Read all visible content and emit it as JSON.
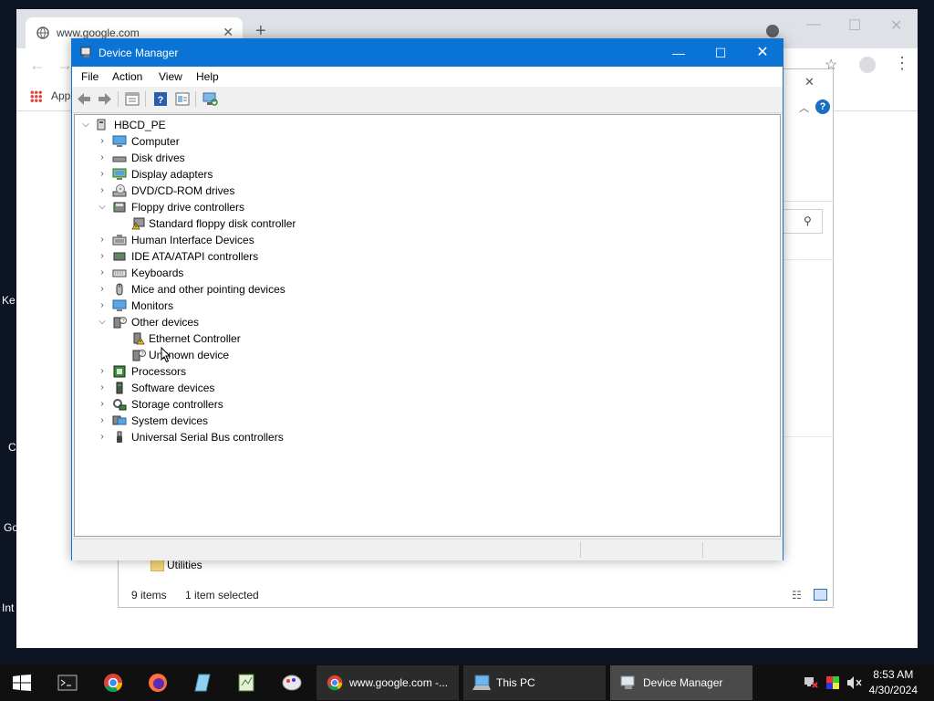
{
  "desktop": {
    "side_labels": [
      "Ke",
      "C",
      "Go",
      "Int"
    ]
  },
  "chrome": {
    "tab_title": "www.google.com",
    "apps_label": "Apps"
  },
  "explorer": {
    "folder_label": "Utilities",
    "item_count": "9 items",
    "selection": "1 item selected"
  },
  "device_manager": {
    "title": "Device Manager",
    "menu": [
      "File",
      "Action",
      "View",
      "Help"
    ],
    "root": "HBCD_PE",
    "tree": [
      {
        "label": "Computer",
        "expanded": false,
        "icon": "computer-icon"
      },
      {
        "label": "Disk drives",
        "expanded": false,
        "icon": "disk-icon"
      },
      {
        "label": "Display adapters",
        "expanded": false,
        "icon": "display-icon"
      },
      {
        "label": "DVD/CD-ROM drives",
        "expanded": false,
        "icon": "dvd-icon"
      },
      {
        "label": "Floppy drive controllers",
        "expanded": true,
        "icon": "floppy-icon",
        "children": [
          {
            "label": "Standard floppy disk controller",
            "icon": "warning-device-icon"
          }
        ]
      },
      {
        "label": "Human Interface Devices",
        "expanded": false,
        "icon": "hid-icon"
      },
      {
        "label": "IDE ATA/ATAPI controllers",
        "expanded": false,
        "icon": "ide-icon"
      },
      {
        "label": "Keyboards",
        "expanded": false,
        "icon": "keyboard-icon"
      },
      {
        "label": "Mice and other pointing devices",
        "expanded": false,
        "icon": "mouse-icon"
      },
      {
        "label": "Monitors",
        "expanded": false,
        "icon": "monitor-icon"
      },
      {
        "label": "Other devices",
        "expanded": true,
        "icon": "unknown-device-icon",
        "children": [
          {
            "label": "Ethernet Controller",
            "icon": "warning-device-icon"
          },
          {
            "label": "Unknown device",
            "icon": "unknown-device-icon"
          }
        ]
      },
      {
        "label": "Processors",
        "expanded": false,
        "icon": "processor-icon"
      },
      {
        "label": "Software devices",
        "expanded": false,
        "icon": "software-icon"
      },
      {
        "label": "Storage controllers",
        "expanded": false,
        "icon": "storage-icon"
      },
      {
        "label": "System devices",
        "expanded": false,
        "icon": "system-icon"
      },
      {
        "label": "Universal Serial Bus controllers",
        "expanded": false,
        "icon": "usb-icon"
      }
    ]
  },
  "taskbar": {
    "apps": [
      {
        "label": "www.google.com -...",
        "icon": "chrome-icon"
      },
      {
        "label": "This PC",
        "icon": "this-pc-icon"
      },
      {
        "label": "Device Manager",
        "icon": "device-manager-icon",
        "active": true
      }
    ],
    "time": "8:53 AM",
    "date": "4/30/2024"
  },
  "colors": {
    "title_bar": "#0a74d6",
    "taskbar": "#101010",
    "desktop": "#0d1424"
  }
}
